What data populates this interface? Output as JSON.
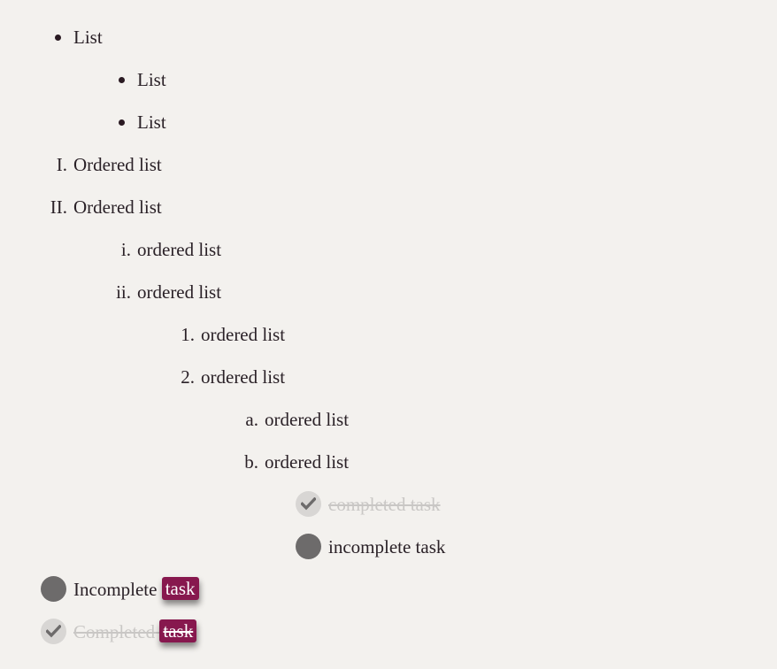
{
  "lists": {
    "bullet_item_1": "List",
    "bullet_item_2": "List",
    "bullet_item_3": "List",
    "ordered_roman_1_marker": "I.",
    "ordered_roman_1": "Ordered list",
    "ordered_roman_2_marker": "II.",
    "ordered_roman_2": "Ordered list",
    "ordered_lower_roman_1_marker": "i.",
    "ordered_lower_roman_1": "ordered list",
    "ordered_lower_roman_2_marker": "ii.",
    "ordered_lower_roman_2": "ordered list",
    "ordered_num_1_marker": "1.",
    "ordered_num_1": "ordered list",
    "ordered_num_2_marker": "2.",
    "ordered_num_2": "ordered list",
    "ordered_alpha_1_marker": "a.",
    "ordered_alpha_1": "ordered list",
    "ordered_alpha_2_marker": "b.",
    "ordered_alpha_2": "ordered list"
  },
  "tasks": {
    "nested_completed": "completed task",
    "nested_incomplete": "incomplete task",
    "top_incomplete_text": "Incomplete",
    "top_incomplete_tag": "task",
    "top_completed_text": "Completed",
    "top_completed_tag": "task"
  },
  "colors": {
    "background": "#f3f1ee",
    "text": "#2a2127",
    "tag_background": "#87184e",
    "checkbox_done": "#d8d6d4",
    "checkbox_todo": "#6d6b6b",
    "completed_text": "#c9c7c5"
  },
  "icons": {
    "checkbox_checked": "check-mark-icon",
    "checkbox_unchecked": "filled-circle-icon"
  }
}
